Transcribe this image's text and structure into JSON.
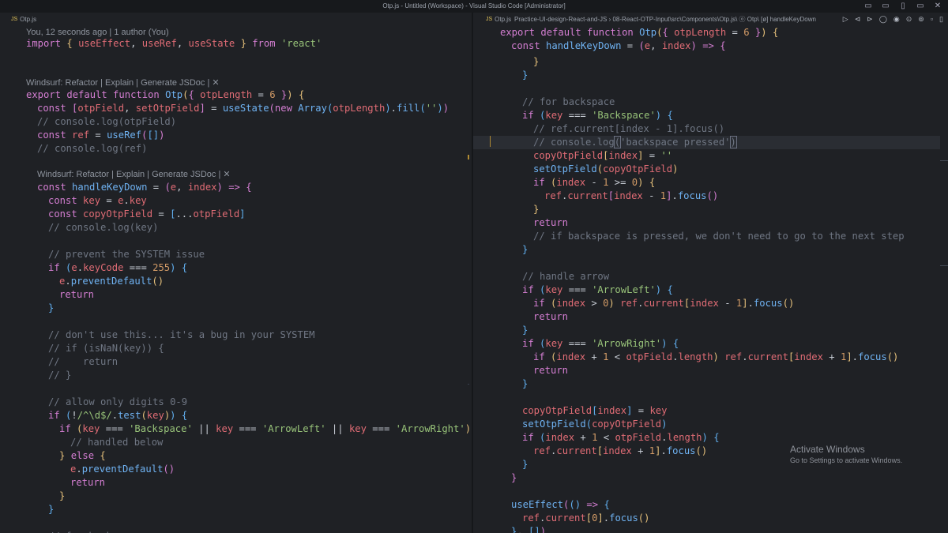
{
  "window": {
    "title": "Otp.js - Untitled (Workspace) - Visual Studio Code [Administrator]",
    "controls": [
      "▭",
      "▭",
      "▯",
      "▭",
      "✕"
    ]
  },
  "left": {
    "tab_label": "Otp.js",
    "blame": "You, 12 seconds ago | 1 author (You)",
    "lens1": "Windsurf: Refactor | Explain | Generate JSDoc | ✕",
    "lens2": "Windsurf: Refactor | Explain | Generate JSDoc | ✕"
  },
  "right": {
    "tab_label": "Otp.js",
    "breadcrumb": "Practice-UI-design-React-and-JS › 08-React-OTP-Input\\src\\Components\\Otp.js\\ ⓞ Otp\\ [ø] handleKeyDown",
    "toolbar": [
      "▷",
      "⊲",
      "⊳",
      "◯",
      "◉",
      "⊙",
      "⊚",
      "▫",
      "▯"
    ]
  },
  "watermark": {
    "line1": "Activate Windows",
    "line2": "Go to Settings to activate Windows."
  }
}
